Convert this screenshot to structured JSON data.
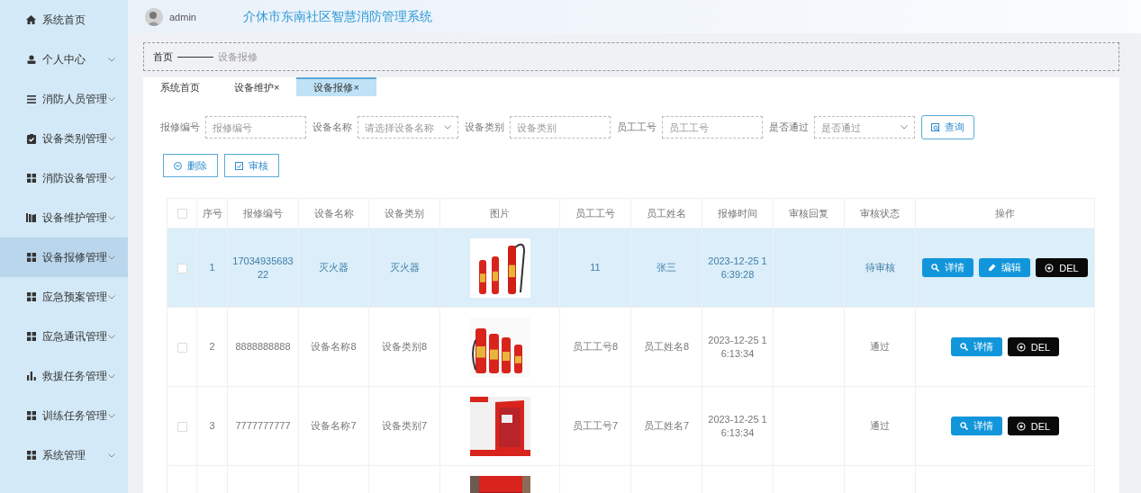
{
  "sidebar": {
    "items": [
      {
        "label": "系统首页",
        "kind": "home",
        "expandable": false,
        "selected": false
      },
      {
        "label": "个人中心",
        "kind": "person",
        "expandable": true,
        "selected": false
      },
      {
        "label": "消防人员管理",
        "kind": "list",
        "expandable": true,
        "selected": false
      },
      {
        "label": "设备类别管理",
        "kind": "clipboard",
        "expandable": true,
        "selected": false
      },
      {
        "label": "消防设备管理",
        "kind": "grid",
        "expandable": true,
        "selected": false
      },
      {
        "label": "设备维护管理",
        "kind": "books",
        "expandable": true,
        "selected": false
      },
      {
        "label": "设备报修管理",
        "kind": "grid",
        "expandable": true,
        "selected": true
      },
      {
        "label": "应急预案管理",
        "kind": "grid",
        "expandable": true,
        "selected": false
      },
      {
        "label": "应急通讯管理",
        "kind": "grid",
        "expandable": true,
        "selected": false
      },
      {
        "label": "救援任务管理",
        "kind": "bars",
        "expandable": true,
        "selected": false
      },
      {
        "label": "训练任务管理",
        "kind": "grid",
        "expandable": true,
        "selected": false
      },
      {
        "label": "系统管理",
        "kind": "grid",
        "expandable": true,
        "selected": false
      }
    ]
  },
  "header": {
    "user": "admin",
    "title": "介休市东南社区智慧消防管理系统"
  },
  "breadcrumb": {
    "home": "首页",
    "current": "设备报修"
  },
  "tabs": [
    {
      "label": "系统首页",
      "selected": false
    },
    {
      "label": "设备维护×",
      "selected": false
    },
    {
      "label": "设备报修×",
      "selected": true
    }
  ],
  "filters": [
    {
      "label": "报修编号",
      "placeholder": "报修编号",
      "kind": "text"
    },
    {
      "label": "设备名称",
      "placeholder": "请选择设备名称",
      "kind": "select"
    },
    {
      "label": "设备类别",
      "placeholder": "设备类别",
      "kind": "text"
    },
    {
      "label": "员工工号",
      "placeholder": "员工工号",
      "kind": "text"
    },
    {
      "label": "是否通过",
      "placeholder": "是否通过",
      "kind": "select"
    }
  ],
  "query_button": "查询",
  "bulk_buttons": [
    {
      "label": "删除",
      "kind": "delete"
    },
    {
      "label": "审核",
      "kind": "review"
    }
  ],
  "table": {
    "header_checked": false,
    "columns": [
      "序号",
      "报修编号",
      "设备名称",
      "设备类别",
      "图片",
      "员工工号",
      "员工姓名",
      "报修时间",
      "审核回复",
      "审核状态",
      "操作"
    ],
    "rows": [
      {
        "selected": true,
        "checked": false,
        "cells": [
          "1",
          "1703493568322",
          "灭火器",
          "灭火器",
          "",
          "11",
          "张三",
          "2023-12-25 16:39:28",
          "",
          "待审核"
        ],
        "actions": [
          {
            "kind": "detail",
            "label": "详情"
          },
          {
            "kind": "edit",
            "label": "编辑"
          },
          {
            "kind": "delete",
            "label": "DEL"
          }
        ]
      },
      {
        "selected": false,
        "checked": false,
        "cells": [
          "2",
          "8888888888",
          "设备名称8",
          "设备类别8",
          "",
          "员工工号8",
          "员工姓名8",
          "2023-12-25 16:13:34",
          "",
          "通过"
        ],
        "actions": [
          {
            "kind": "detail",
            "label": "详情"
          },
          {
            "kind": "delete",
            "label": "DEL"
          }
        ]
      },
      {
        "selected": false,
        "checked": false,
        "cells": [
          "3",
          "7777777777",
          "设备名称7",
          "设备类别7",
          "",
          "员工工号7",
          "员工姓名7",
          "2023-12-25 16:13:34",
          "",
          "通过"
        ],
        "actions": [
          {
            "kind": "detail",
            "label": "详情"
          },
          {
            "kind": "delete",
            "label": "DEL"
          }
        ]
      },
      {
        "selected": false
      }
    ]
  }
}
